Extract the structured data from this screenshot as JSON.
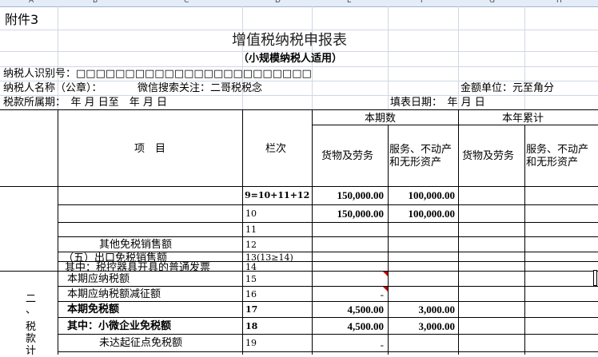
{
  "columns": [
    "A",
    "B",
    "C",
    "D",
    "E",
    "F",
    "G",
    "H"
  ],
  "attachment": "附件3",
  "title": "增值税纳税申报表",
  "subtitle": "（小规模纳税人适用）",
  "taxpayer_id_label": "纳税人识别号：□□□□□□□□□□□□□□□□□□□□□□□□",
  "taxpayer_name_label": "纳税人名称（公章）：",
  "wechat_note": "微信搜索关注：二哥税税念",
  "unit_label": "金额单位：元至角分",
  "period_label": "税款所属期：　年  月  日至　年  月  日",
  "fill_date_label": "填表日期：　年  月  日",
  "header": {
    "item": "项　目",
    "line_no": "栏次",
    "current_period": "本期数",
    "year_total": "本年累计",
    "goods": "货物及劳务",
    "services_1": "服务、不动产",
    "services_2": "和无形资产"
  },
  "rows": [
    {
      "label": "",
      "line": "9=10+11+12",
      "goods": "150,000.00",
      "services": "100,000.00"
    },
    {
      "label": "",
      "line": "10",
      "goods": "150,000.00",
      "services": "100,000.00"
    },
    {
      "label": "",
      "line": "11",
      "goods": "",
      "services": ""
    },
    {
      "label": "其他免税销售额",
      "line": "12",
      "goods": "",
      "services": ""
    },
    {
      "label": "（五）出口免税销售额",
      "line": "13(13≥14)",
      "goods": "",
      "services": ""
    },
    {
      "label": "其中：税控器具开具的普通发票",
      "line": "14",
      "goods": "",
      "services": ""
    },
    {
      "label": "本期应纳税额",
      "line": "15",
      "goods": "",
      "services": ""
    },
    {
      "label": "本期应纳税额减征额",
      "line": "16",
      "goods": "-",
      "services": ""
    },
    {
      "label": "本期免税额",
      "line": "17",
      "goods": "4,500.00",
      "services": "3,000.00"
    },
    {
      "label": "其中：小微企业免税额",
      "line": "18",
      "goods": "4,500.00",
      "services": "3,000.00"
    },
    {
      "label": "未达起征点免税额",
      "line": "19",
      "goods": "-",
      "services": ""
    }
  ],
  "section2_label": [
    "二",
    "、",
    "税",
    "款",
    "计"
  ]
}
